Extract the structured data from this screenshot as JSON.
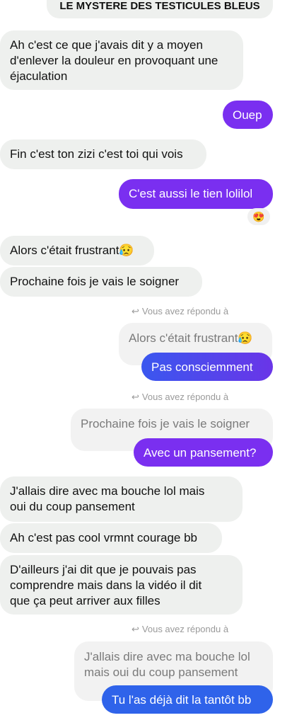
{
  "header": {
    "title": "LE MYSTERE DES TESTICULES BLEUS"
  },
  "messages": {
    "m1": "Ah c'est ce que j'avais dit y a moyen\nd'enlever la douleur en provoquant une\néjaculation",
    "m2": "Ouep",
    "m3": "Fin c'est ton zizi c'est toi qui vois",
    "m4": "C'est aussi le tien lolilol",
    "m4_reaction": "😍",
    "m5": "Alors c'était frustrant😥",
    "m6": "Prochaine fois je vais le soigner",
    "reply1_note": "Vous avez répondu à",
    "reply1_quote": "Alors c'était frustrant😥",
    "reply1_msg": "Pas consciemment",
    "reply2_note": "Vous avez répondu à",
    "reply2_quote": "Prochaine fois je vais le soigner",
    "reply2_msg": "Avec un pansement?",
    "m7": "J'allais dire avec ma bouche lol mais\noui du coup pansement",
    "m8": "Ah c'est pas cool vrmnt courage bb",
    "m9": "D'ailleurs j'ai dit que je pouvais pas\ncomprendre mais dans la vidéo il dit\nque ça peut arriver aux filles",
    "reply3_note": "Vous avez répondu à",
    "reply3_quote": "J'allais dire avec ma bouche lol\nmais oui du coup pansement",
    "reply3_msg": "Tu l'as déjà dit la tantôt bb"
  },
  "colors": {
    "purple": "#7a2ff0",
    "blue": "#2f63ea",
    "received_bg": "#eef0ee"
  },
  "icons": {
    "reply": "reply-arrow-icon"
  }
}
